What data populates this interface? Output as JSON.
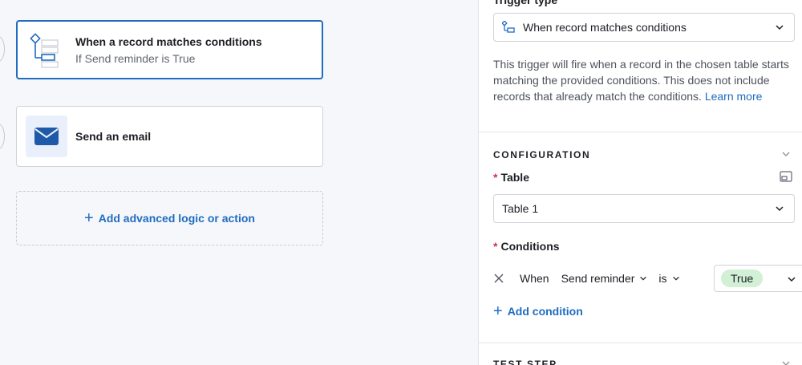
{
  "canvas": {
    "trigger_card": {
      "title": "When a record matches conditions",
      "subtitle": "If Send reminder is True"
    },
    "action_card": {
      "title": "Send an email"
    },
    "add_logic_label": "Add advanced logic or action"
  },
  "panel": {
    "trigger_type_label": "Trigger type",
    "trigger_type_value": "When record matches conditions",
    "description": "This trigger will fire when a record in the chosen table starts matching the provided conditions. This does not include records that already match the conditions.",
    "learn_more": "Learn more",
    "configuration": {
      "title": "CONFIGURATION",
      "table_label": "Table",
      "table_value": "Table 1",
      "conditions_label": "Conditions",
      "condition": {
        "when": "When",
        "field": "Send reminder",
        "operator": "is",
        "value": "True"
      },
      "add_condition": "Add condition"
    },
    "test_step_title": "TEST STEP"
  },
  "colors": {
    "accent": "#1f6cc0",
    "required": "#d1334a",
    "pill_bg": "#d1f0d5"
  }
}
